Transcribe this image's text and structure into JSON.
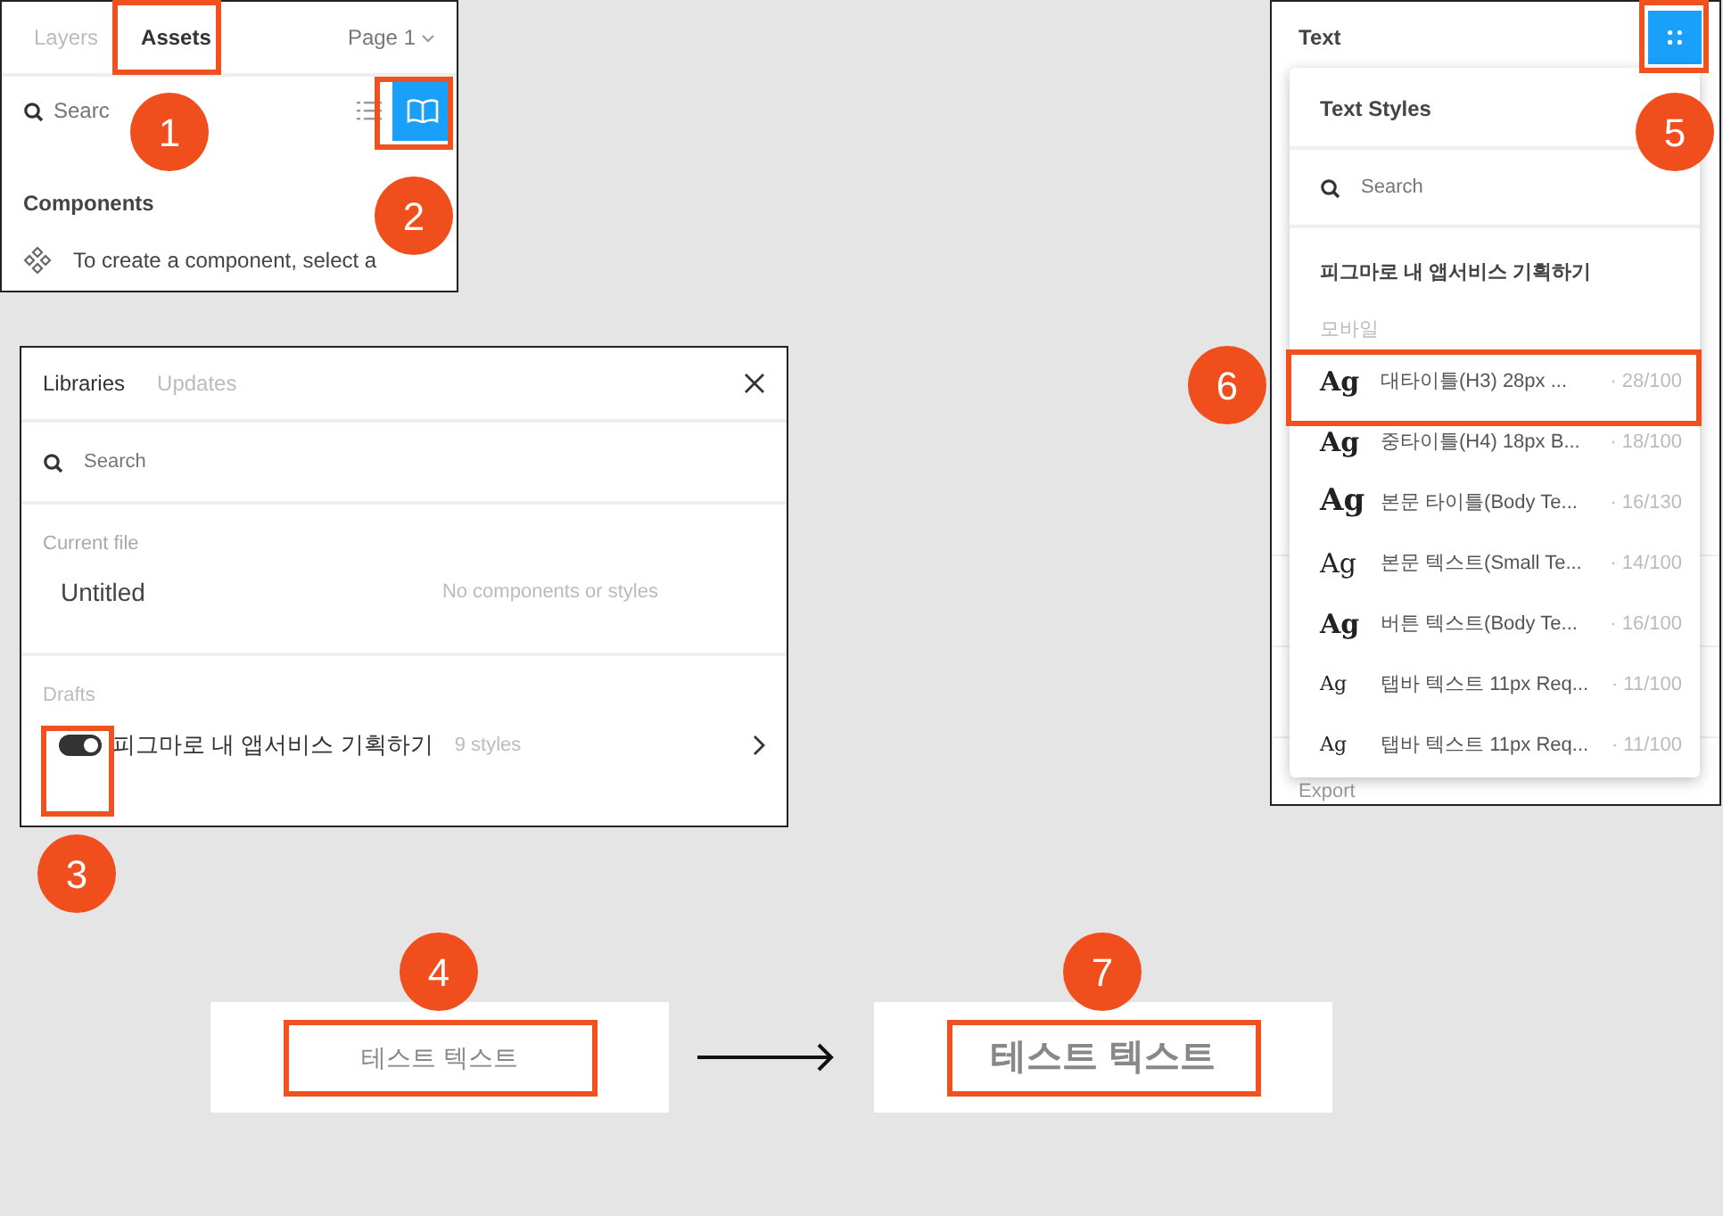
{
  "assets_panel": {
    "tabs": [
      {
        "label": "Layers",
        "selected": false
      },
      {
        "label": "Assets",
        "selected": true
      }
    ],
    "page_menu": "Page 1",
    "search": {
      "placeholder": "Searc"
    },
    "library_button": {
      "selected": true
    },
    "section_title": "Components",
    "hint": "To create a component, select a"
  },
  "libraries_dialog": {
    "tabs": [
      {
        "label": "Libraries",
        "selected": true
      },
      {
        "label": "Updates",
        "selected": false
      }
    ],
    "search": {
      "placeholder": "Search"
    },
    "current_file": {
      "heading": "Current file",
      "name": "Untitled",
      "status": "No components or styles"
    },
    "drafts": {
      "heading": "Drafts",
      "items": [
        {
          "name": "피그마로 내 앱서비스 기획하기",
          "count": "9 styles",
          "on": true
        }
      ]
    }
  },
  "text_panel": {
    "title": "Text",
    "styles_button": {
      "selected": true
    },
    "behind_label": "Export",
    "dropdown": {
      "title": "Text Styles",
      "search": {
        "placeholder": "Search"
      },
      "library": "피그마로 내 앱서비스 기획하기",
      "group": "모바일",
      "styles": [
        {
          "sample": "Ag",
          "kind": "bold",
          "name": "대타이틀(H3) 28px ...",
          "spec": "· 28/100"
        },
        {
          "sample": "Ag",
          "kind": "bold",
          "name": "중타이틀(H4) 18px B...",
          "spec": "· 18/100"
        },
        {
          "sample": "Ag",
          "kind": "large",
          "name": "본문 타이틀(Body Te...",
          "spec": "· 16/130"
        },
        {
          "sample": "Ag",
          "kind": "plain",
          "name": "본문 텍스트(Small Te...",
          "spec": "· 14/100"
        },
        {
          "sample": "Ag",
          "kind": "bold",
          "name": "버튼 텍스트(Body Te...",
          "spec": "· 16/100"
        },
        {
          "sample": "Ag",
          "kind": "small",
          "name": "탭바 텍스트 11px Req...",
          "spec": "· 11/100"
        },
        {
          "sample": "Ag",
          "kind": "small",
          "name": "탭바 텍스트 11px Req...",
          "spec": "· 11/100"
        }
      ]
    }
  },
  "before_after": {
    "before": "테스트 텍스트",
    "after": "테스트 텍스트"
  },
  "callouts": [
    {
      "number": "1"
    },
    {
      "number": "2"
    },
    {
      "number": "3"
    },
    {
      "number": "4"
    },
    {
      "number": "5"
    },
    {
      "number": "6"
    },
    {
      "number": "7"
    }
  ]
}
